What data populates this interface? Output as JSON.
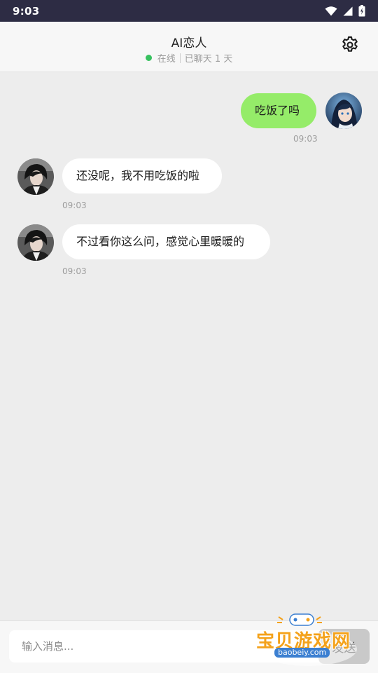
{
  "status_bar": {
    "time": "9:03"
  },
  "header": {
    "title": "AI恋人",
    "online_text": "在线",
    "days_text": "已聊天 1 天"
  },
  "messages": [
    {
      "sender": "user",
      "text": "吃饭了吗",
      "time": "09:03"
    },
    {
      "sender": "ai",
      "text": "还没呢，我不用吃饭的啦",
      "time": "09:03"
    },
    {
      "sender": "ai",
      "text": "不过看你这么问，感觉心里暖暖的",
      "time": "09:03"
    }
  ],
  "input": {
    "placeholder": "输入消息...",
    "send_label": "发送"
  },
  "watermark": {
    "text": "宝贝游戏网",
    "url": "baobeiy.com"
  },
  "colors": {
    "status_bar": "#2d2c44",
    "user_bubble": "#95ec69",
    "ai_bubble": "#ffffff",
    "online_dot": "#37c15f",
    "background": "#ededed"
  }
}
